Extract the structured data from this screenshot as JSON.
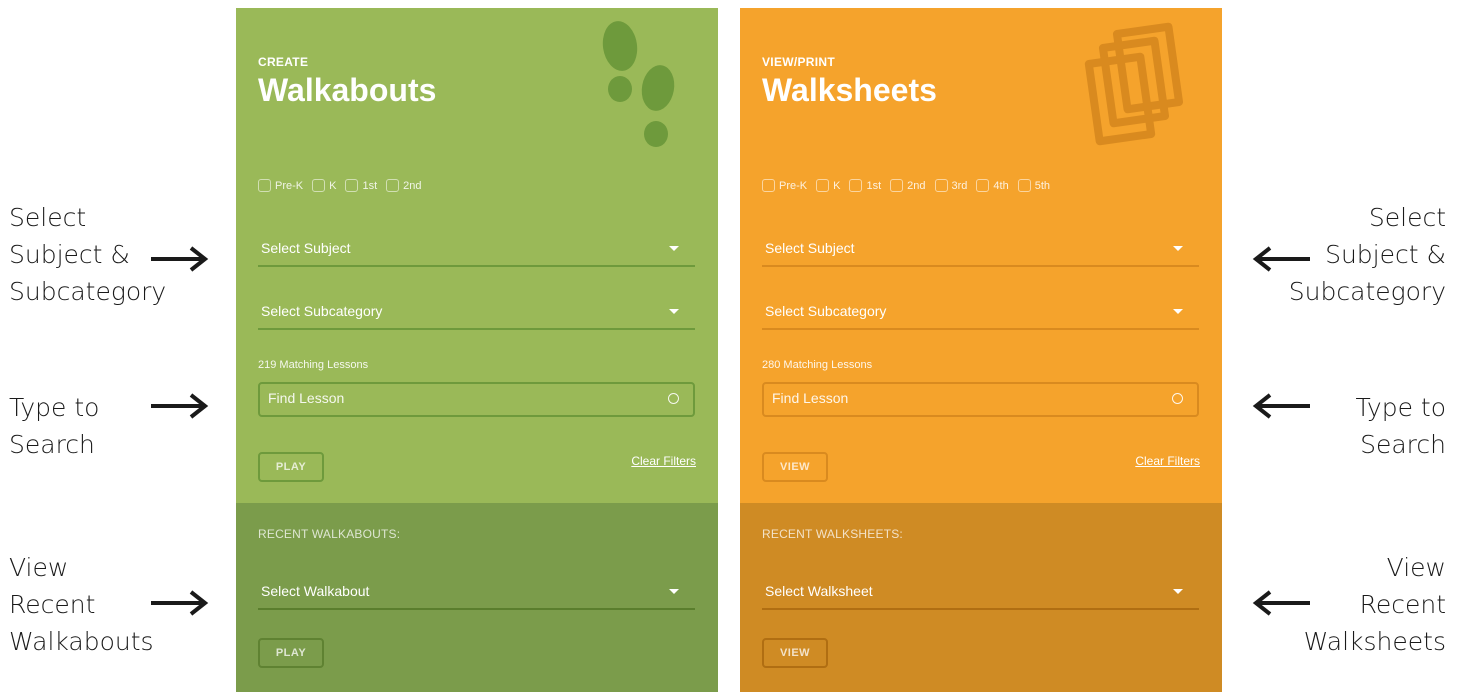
{
  "annotations": {
    "left_subject": [
      "Select",
      "Subject &",
      "Subcategory"
    ],
    "left_search": [
      "Type to",
      "Search"
    ],
    "left_recent": [
      "View",
      "Recent",
      "Walkabouts"
    ],
    "right_subject": [
      "Select",
      "Subject &",
      "Subcategory"
    ],
    "right_search": [
      "Type to",
      "Search"
    ],
    "right_recent": [
      "View",
      "Recent",
      "Walksheets"
    ]
  },
  "walkabouts": {
    "eyebrow": "CREATE",
    "title": "Walkabouts",
    "icon": "footprints-icon",
    "color": "#9ab958",
    "grades": [
      "Pre-K",
      "K",
      "1st",
      "2nd"
    ],
    "subject_placeholder": "Select Subject",
    "subcategory_placeholder": "Select Subcategory",
    "count_text": "219 Matching Lessons",
    "search_placeholder": "Find Lesson",
    "action_button": "PLAY",
    "clear_filters": "Clear Filters",
    "recent_label": "RECENT WALKABOUTS:",
    "recent_select": "Select Walkabout",
    "recent_button": "PLAY"
  },
  "walksheets": {
    "eyebrow": "VIEW/PRINT",
    "title": "Walksheets",
    "icon": "sheets-icon",
    "color": "#f5a32c",
    "grades": [
      "Pre-K",
      "K",
      "1st",
      "2nd",
      "3rd",
      "4th",
      "5th"
    ],
    "subject_placeholder": "Select Subject",
    "subcategory_placeholder": "Select Subcategory",
    "count_text": "280 Matching Lessons",
    "search_placeholder": "Find Lesson",
    "action_button": "VIEW",
    "clear_filters": "Clear Filters",
    "recent_label": "RECENT WALKSHEETS:",
    "recent_select": "Select Walksheet",
    "recent_button": "VIEW"
  }
}
